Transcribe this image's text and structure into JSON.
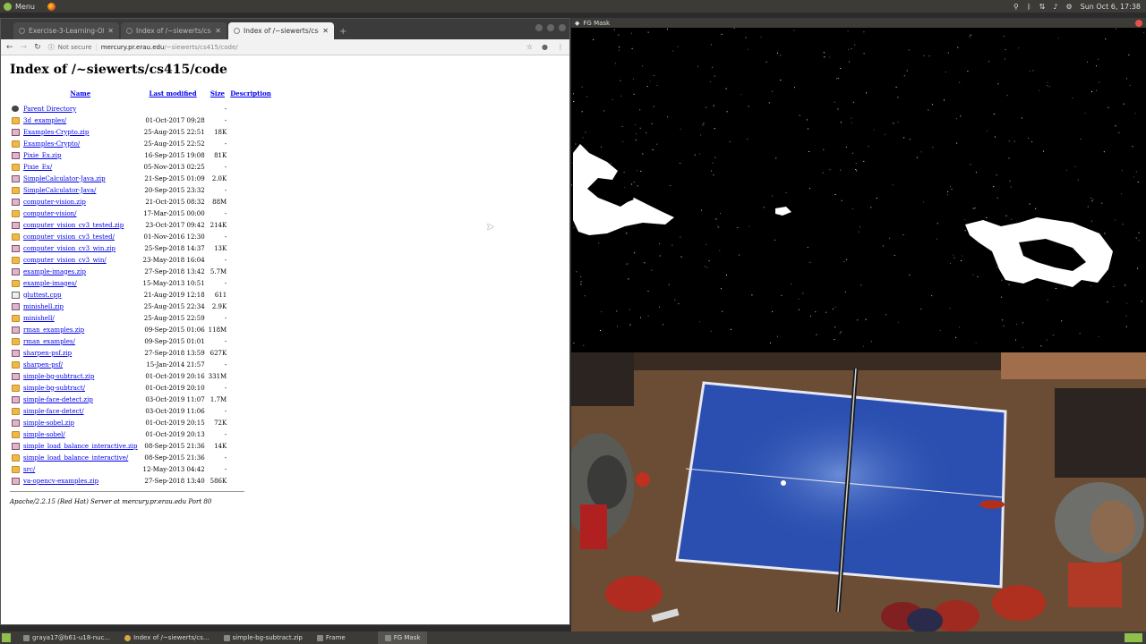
{
  "top_panel": {
    "menu_label": "Menu",
    "clock": "Sun Oct 6, 17:38"
  },
  "browser": {
    "tabs": [
      {
        "label": "Exercise-3-Learning-Obje",
        "active": false
      },
      {
        "label": "Index of /~siewerts/cs41",
        "active": false
      },
      {
        "label": "Index of /~siewerts/cs41",
        "active": true
      }
    ],
    "not_secure": "Not secure",
    "url_host": "mercury.pr.erau.edu",
    "url_path": "/~siewerts/cs415/code/"
  },
  "listing": {
    "title": "Index of /~siewerts/cs415/code",
    "headers": {
      "name": "Name",
      "last_modified": "Last modified",
      "size": "Size",
      "description": "Description"
    },
    "parent": {
      "name": "Parent Directory",
      "size": "-"
    },
    "rows": [
      {
        "type": "folder",
        "name": "3d_examples/",
        "date": "01-Oct-2017 09:28",
        "size": "-"
      },
      {
        "type": "zip",
        "name": "Examples-Crypto.zip",
        "date": "25-Aug-2015 22:51",
        "size": "18K"
      },
      {
        "type": "folder",
        "name": "Examples-Crypto/",
        "date": "25-Aug-2015 22:52",
        "size": "-"
      },
      {
        "type": "zip",
        "name": "Pixie_Ex.zip",
        "date": "16-Sep-2015 19:08",
        "size": "81K"
      },
      {
        "type": "folder",
        "name": "Pixie_Ex/",
        "date": "05-Nov-2013 02:25",
        "size": "-"
      },
      {
        "type": "zip",
        "name": "SimpleCalculator-Java.zip",
        "date": "21-Sep-2015 01:09",
        "size": "2.0K"
      },
      {
        "type": "folder",
        "name": "SimpleCalculator-Java/",
        "date": "20-Sep-2015 23:32",
        "size": "-"
      },
      {
        "type": "zip",
        "name": "computer-vision.zip",
        "date": "21-Oct-2015 08:32",
        "size": "88M"
      },
      {
        "type": "folder",
        "name": "computer-vision/",
        "date": "17-Mar-2015 00:00",
        "size": "-"
      },
      {
        "type": "zip",
        "name": "computer_vision_cv3_tested.zip",
        "date": "23-Oct-2017 09:42",
        "size": "214K"
      },
      {
        "type": "folder",
        "name": "computer_vision_cv3_tested/",
        "date": "01-Nov-2016 12:30",
        "size": "-"
      },
      {
        "type": "zip",
        "name": "computer_vision_cv3_win.zip",
        "date": "25-Sep-2018 14:37",
        "size": "13K"
      },
      {
        "type": "folder",
        "name": "computer_vision_cv3_win/",
        "date": "23-May-2018 16:04",
        "size": "-"
      },
      {
        "type": "zip",
        "name": "example-images.zip",
        "date": "27-Sep-2018 13:42",
        "size": "5.7M"
      },
      {
        "type": "folder",
        "name": "example-images/",
        "date": "15-May-2013 10:51",
        "size": "-"
      },
      {
        "type": "file",
        "name": "gluttest.cpp",
        "date": "21-Aug-2019 12:18",
        "size": "611"
      },
      {
        "type": "zip",
        "name": "minishell.zip",
        "date": "25-Aug-2015 22:34",
        "size": "2.9K"
      },
      {
        "type": "folder",
        "name": "minishell/",
        "date": "25-Aug-2015 22:59",
        "size": "-"
      },
      {
        "type": "zip",
        "name": "rman_examples.zip",
        "date": "09-Sep-2015 01:06",
        "size": "118M"
      },
      {
        "type": "folder",
        "name": "rman_examples/",
        "date": "09-Sep-2015 01:01",
        "size": "-"
      },
      {
        "type": "zip",
        "name": "sharpen-psf.zip",
        "date": "27-Sep-2018 13:59",
        "size": "627K"
      },
      {
        "type": "folder",
        "name": "sharpen-psf/",
        "date": "15-Jan-2014 21:57",
        "size": "-"
      },
      {
        "type": "zip",
        "name": "simple-bg-subtract.zip",
        "date": "01-Oct-2019 20:16",
        "size": "331M"
      },
      {
        "type": "folder",
        "name": "simple-bg-subtract/",
        "date": "01-Oct-2019 20:10",
        "size": "-"
      },
      {
        "type": "zip",
        "name": "simple-face-detect.zip",
        "date": "03-Oct-2019 11:07",
        "size": "1.7M"
      },
      {
        "type": "folder",
        "name": "simple-face-detect/",
        "date": "03-Oct-2019 11:06",
        "size": "-"
      },
      {
        "type": "zip",
        "name": "simple-sobel.zip",
        "date": "01-Oct-2019 20:15",
        "size": "72K"
      },
      {
        "type": "folder",
        "name": "simple-sobel/",
        "date": "01-Oct-2019 20:13",
        "size": "-"
      },
      {
        "type": "zip",
        "name": "simple_load_balance_interactive.zip",
        "date": "08-Sep-2015 21:36",
        "size": "14K"
      },
      {
        "type": "folder",
        "name": "simple_load_balance_interactive/",
        "date": "08-Sep-2015 21:36",
        "size": "-"
      },
      {
        "type": "folder",
        "name": "src/",
        "date": "12-May-2013 04:42",
        "size": "-"
      },
      {
        "type": "zip",
        "name": "va-opencv-examples.zip",
        "date": "27-Sep-2018 13:40",
        "size": "586K"
      }
    ],
    "server_signature": "Apache/2.2.15 (Red Hat) Server at mercury.pr.erau.edu Port 80"
  },
  "fgmask_window": {
    "title": "FG Mask"
  },
  "taskbar": {
    "items": [
      {
        "label": "graya17@b61-u18-nuc...",
        "icon": "terminal-icon"
      },
      {
        "label": "Index of /~siewerts/cs...",
        "icon": "chrome-icon"
      },
      {
        "label": "simple-bg-subtract.zip",
        "icon": "archive-icon"
      },
      {
        "label": "Frame",
        "icon": "window-icon"
      },
      {
        "label": "FG Mask",
        "icon": "window-icon"
      }
    ]
  },
  "colors": {
    "table_blue": "#2a4fb0",
    "floor_brown": "#6b4c35",
    "link_blue": "#0000ee"
  }
}
